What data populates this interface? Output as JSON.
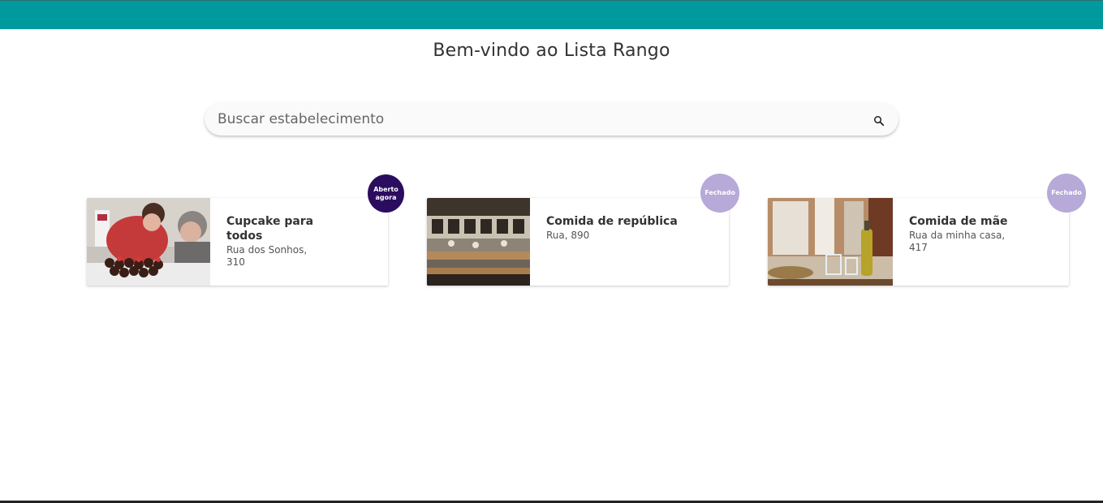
{
  "header": {
    "title": "Bem-vindo ao Lista Rango"
  },
  "search": {
    "placeholder": "Buscar estabelecimento",
    "icon": "search-icon"
  },
  "colors": {
    "topbar": "#009a9e",
    "badge_open": "#2b0d5f",
    "badge_closed": "#b7a9d8"
  },
  "restaurants": [
    {
      "name": "Cupcake para todos",
      "address": "Rua dos Sonhos, 310",
      "status": "Aberto agora",
      "open": true
    },
    {
      "name": "Comida de república",
      "address": "Rua, 890",
      "status": "Fechado",
      "open": false
    },
    {
      "name": "Comida de mãe",
      "address": "Rua da minha casa, 417",
      "status": "Fechado",
      "open": false
    }
  ]
}
